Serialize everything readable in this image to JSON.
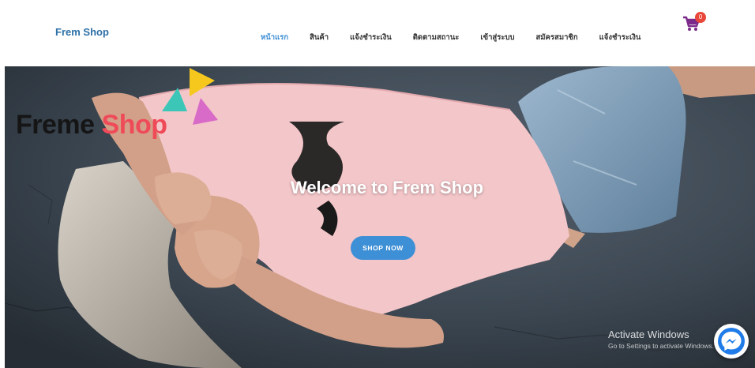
{
  "header": {
    "brand": "Frem Shop",
    "nav": [
      {
        "label": "หน้าแรก",
        "active": true
      },
      {
        "label": "สินค้า",
        "active": false
      },
      {
        "label": "แจ้งชำระเงิน",
        "active": false
      },
      {
        "label": "ติดตามสถานะ",
        "active": false
      },
      {
        "label": "เข้าสู่ระบบ",
        "active": false
      },
      {
        "label": "สมัครสมาชิก",
        "active": false
      },
      {
        "label": "แจ้งชำระเงิน",
        "active": false
      }
    ],
    "cart": {
      "icon": "cart-icon",
      "count": "0",
      "color": "#7b2a8a"
    }
  },
  "hero": {
    "logo_word1": "Freme",
    "logo_word2": "Shop",
    "title": "Welcome to Frem Shop",
    "button_label": "SHOP NOW"
  },
  "watermark": {
    "title": "Activate Windows",
    "subtitle": "Go to Settings to activate Windows."
  },
  "colors": {
    "accent": "#3d8fd6",
    "brand": "#2c6fa6",
    "logo_red": "#ef4a57",
    "triangle_yellow": "#f6c81e",
    "triangle_teal": "#3cc6b8",
    "triangle_pink": "#d86bc8"
  },
  "messenger": {
    "icon": "messenger-icon"
  }
}
